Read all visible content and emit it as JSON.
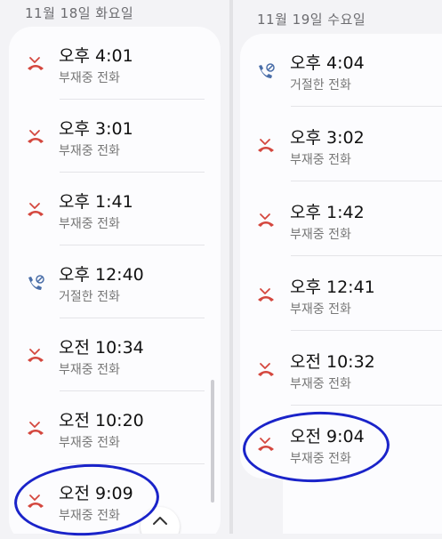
{
  "colors": {
    "missed_call": "#d4473e",
    "rejected_call": "#4a6ea8",
    "highlight_ring": "#1a23c9"
  },
  "left": {
    "date": "11월 18일 화요일",
    "calls": [
      {
        "time": "오후 4:01",
        "status": "부재중 전화",
        "icon": "missed-call-icon"
      },
      {
        "time": "오후 3:01",
        "status": "부재중 전화",
        "icon": "missed-call-icon"
      },
      {
        "time": "오후 1:41",
        "status": "부재중 전화",
        "icon": "missed-call-icon"
      },
      {
        "time": "오후 12:40",
        "status": "거절한 전화",
        "icon": "rejected-call-icon"
      },
      {
        "time": "오전 10:34",
        "status": "부재중 전화",
        "icon": "missed-call-icon"
      },
      {
        "time": "오전 10:20",
        "status": "부재중 전화",
        "icon": "missed-call-icon"
      },
      {
        "time": "오전 9:09",
        "status": "부재중 전화",
        "icon": "missed-call-icon"
      }
    ],
    "scroll_top_icon": "chevron-up-icon"
  },
  "right": {
    "date": "11월 19일 수요일",
    "calls": [
      {
        "time": "오후 4:04",
        "status": "거절한 전화",
        "icon": "rejected-call-icon"
      },
      {
        "time": "오후 3:02",
        "status": "부재중 전화",
        "icon": "missed-call-icon"
      },
      {
        "time": "오후 1:42",
        "status": "부재중 전화",
        "icon": "missed-call-icon"
      },
      {
        "time": "오후 12:41",
        "status": "부재중 전화",
        "icon": "missed-call-icon"
      },
      {
        "time": "오전 10:32",
        "status": "부재중 전화",
        "icon": "missed-call-icon"
      },
      {
        "time": "오전 9:04",
        "status": "부재중 전화",
        "icon": "missed-call-icon"
      }
    ]
  }
}
